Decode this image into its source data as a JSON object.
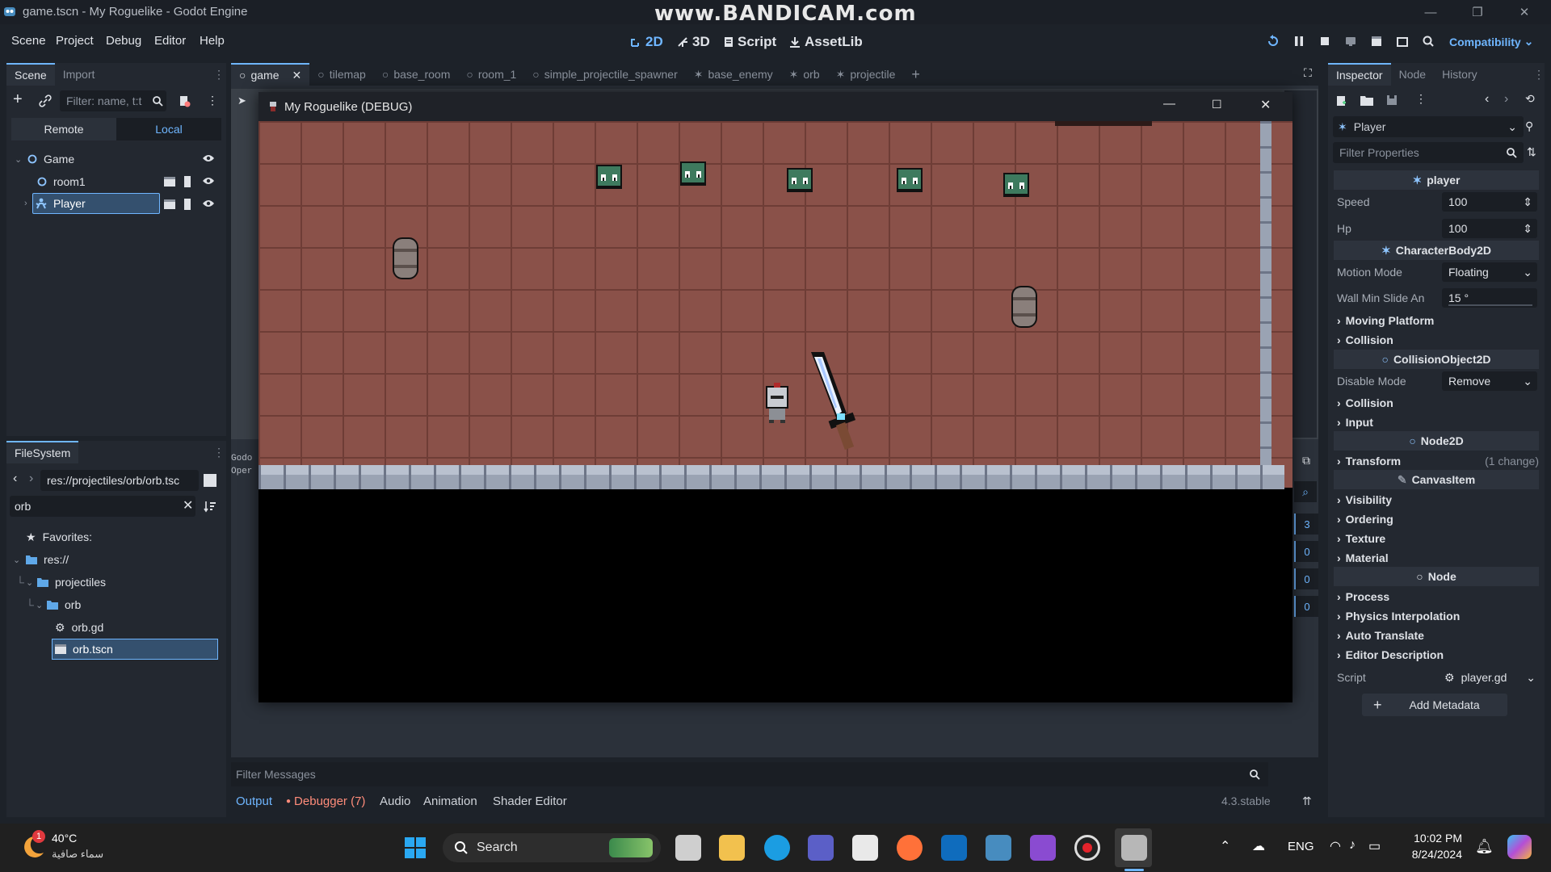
{
  "window": {
    "title": "game.tscn - My Roguelike - Godot Engine",
    "watermark": "www.BANDICAM.com"
  },
  "menu": [
    "Scene",
    "Project",
    "Debug",
    "Editor",
    "Help"
  ],
  "workspaces": [
    "2D",
    "3D",
    "Script",
    "AssetLib"
  ],
  "renderer": "Compatibility",
  "scene_dock": {
    "tabs": [
      "Scene",
      "Import"
    ],
    "filter_placeholder": "Filter: name, t:t",
    "remote": "Remote",
    "local": "Local",
    "nodes": [
      {
        "label": "Game"
      },
      {
        "label": "room1"
      },
      {
        "label": "Player"
      }
    ]
  },
  "filesystem": {
    "tab": "FileSystem",
    "path": "res://projectiles/orb/orb.tsc",
    "search": "orb",
    "items": [
      "Favorites:",
      "res://",
      "projectiles",
      "orb",
      "orb.gd",
      "orb.tscn"
    ]
  },
  "editor_tabs": [
    "game",
    "tilemap",
    "base_room",
    "room_1",
    "simple_projectile_spawner",
    "base_enemy",
    "orb",
    "projectile"
  ],
  "game_window": {
    "title": "My Roguelike (DEBUG)"
  },
  "side_numbers": [
    "3",
    "0",
    "0",
    "0"
  ],
  "output_snippet": [
    "Godo",
    "Oper"
  ],
  "inspector": {
    "tabs": [
      "Inspector",
      "Node",
      "History"
    ],
    "object": "Player",
    "filter_placeholder": "Filter Properties",
    "script_section": "player",
    "speed_label": "Speed",
    "speed": "100",
    "hp_label": "Hp",
    "hp": "100",
    "cb_section": "CharacterBody2D",
    "motion_mode_label": "Motion Mode",
    "motion_mode": "Floating",
    "wall_min_label": "Wall Min Slide An",
    "wall_min": "15 °",
    "moving_platform": "Moving Platform",
    "collision1": "Collision",
    "co_section": "CollisionObject2D",
    "disable_mode_label": "Disable Mode",
    "disable_mode": "Remove",
    "collision2": "Collision",
    "input": "Input",
    "node2d_section": "Node2D",
    "transform": "Transform",
    "transform_change": "(1 change)",
    "canvas_section": "CanvasItem",
    "visibility": "Visibility",
    "ordering": "Ordering",
    "texture": "Texture",
    "material": "Material",
    "node_section": "Node",
    "process": "Process",
    "physics_interp": "Physics Interpolation",
    "auto_translate": "Auto Translate",
    "editor_desc": "Editor Description",
    "script_label": "Script",
    "script_value": "player.gd",
    "add_metadata": "Add Metadata"
  },
  "bottom": {
    "filter_placeholder": "Filter Messages",
    "tabs": [
      "Output",
      "Debugger (7)",
      "Audio",
      "Animation",
      "Shader Editor"
    ],
    "version": "4.3.stable"
  },
  "taskbar": {
    "temp": "40°C",
    "weather": "سماء صافية",
    "badge": "1",
    "search": "Search",
    "lang": "ENG",
    "time": "10:02 PM",
    "date": "8/24/2024"
  },
  "colors": {
    "accent": "#6fb6ff",
    "floor": "#8a5149",
    "debugger": "#ff8c7a"
  }
}
